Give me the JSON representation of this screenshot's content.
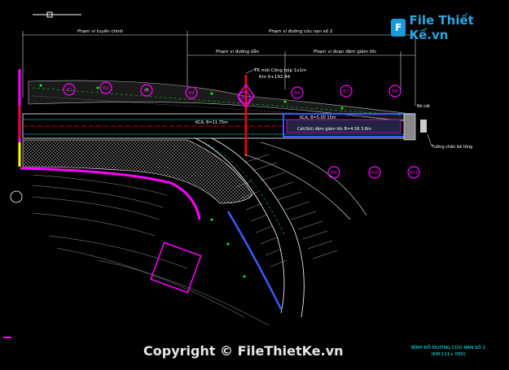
{
  "watermark": {
    "logo_text": "File Thiết Kế.vn",
    "logo_mark": "F",
    "copyright": "Copyright © FileThietKe.vn"
  },
  "labels": {
    "route_scope": "Phạm vi tuyến chính",
    "rescue_scope": "Phạm vi đường cứu nạn số 2",
    "access_scope": "Phạm vi đường dẫn",
    "decel_scope": "Phạm vi đoạn đệm giảm tốc",
    "culvert_note_1": "TK mới Cống hộp 1x1m",
    "culvert_note_2": "Km 0+192.44",
    "road_note_1": "KCA, B=11.75m",
    "road_note_2": "KCA, B=5.00 15m",
    "buffer_note": "Cát(Sỏi) đệm giảm tốc B=4.56 3.8m",
    "wall_note": "Bờ cát",
    "barrier_note": "Tường chắn bê tông",
    "drawing_title_1": "BÌNH ĐỒ ĐƯỜNG CỨU NẠN SỐ 2",
    "drawing_title_2": "(KM 111+ 050)"
  },
  "markers": [
    "Đ1",
    "Đ2",
    "Đ3",
    "Đ4",
    "Đ5",
    "Đ6",
    "Đ7",
    "Đ8",
    "Đ9",
    "Đ10",
    "Đ11"
  ],
  "colors": {
    "cyan": "#00ffff",
    "magenta": "#ff00ff",
    "green": "#00ff00",
    "red": "#ff0000",
    "yellow": "#ffff00",
    "blue": "#3b5bff",
    "white": "#ffffff"
  }
}
